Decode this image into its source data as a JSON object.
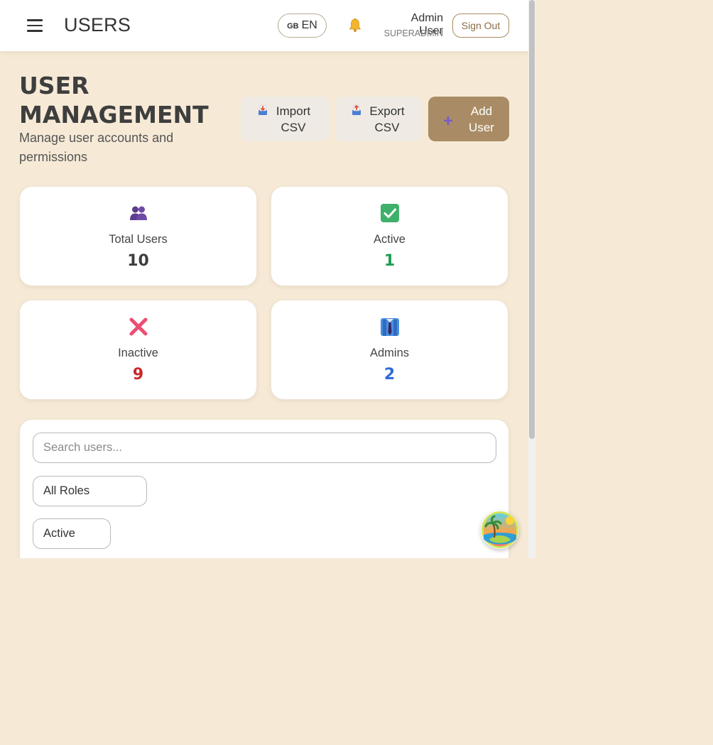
{
  "header": {
    "title": "USERS",
    "language": {
      "flag": "GB",
      "code": "EN"
    },
    "user": {
      "name": "Admin User",
      "role": "SUPERADMIN"
    },
    "sign_out_label": "Sign Out",
    "icons": [
      "hamburger-menu-icon",
      "bell-icon"
    ]
  },
  "page": {
    "title": "USER MANAGEMENT",
    "subtitle": "Manage user accounts and permissions"
  },
  "actions": {
    "import_label": "Import CSV",
    "export_label": "Export CSV",
    "add_label": "Add User"
  },
  "stats": [
    {
      "label": "Total Users",
      "value": "10",
      "color": "#3e3e3e",
      "icon": "users-icon"
    },
    {
      "label": "Active",
      "value": "1",
      "color": "#1f9d55",
      "icon": "check-box-icon"
    },
    {
      "label": "Inactive",
      "value": "9",
      "color": "#c92a2a",
      "icon": "cross-icon"
    },
    {
      "label": "Admins",
      "value": "2",
      "color": "#2f6ad9",
      "icon": "suit-tie-icon"
    }
  ],
  "filters": {
    "search_placeholder": "Search users...",
    "role_selected": "All Roles",
    "status_selected": "Active"
  },
  "colors": {
    "background": "#f6ead7",
    "accent": "#a98c65"
  }
}
